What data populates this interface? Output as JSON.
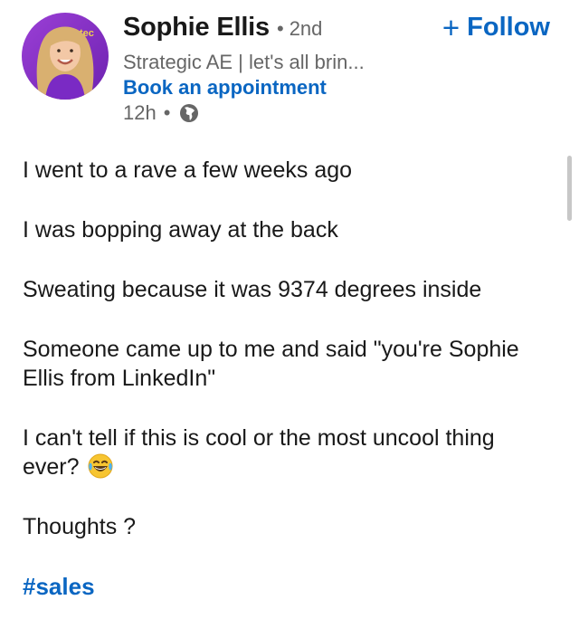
{
  "post": {
    "author": {
      "name": "Sophie Ellis",
      "connection_separator": "•",
      "connection_degree": "2nd",
      "headline": "Strategic AE | let's all brin...",
      "cta_link": "Book an appointment",
      "time_ago": "12h",
      "meta_separator": "•",
      "visibility_icon": "globe-icon",
      "avatar_bg_text": "tec"
    },
    "follow_button": {
      "plus": "+",
      "label": "Follow"
    },
    "paragraphs": [
      "I went to a rave a few weeks ago",
      "I was bopping away at the back",
      "Sweating because it was 9374 degrees inside",
      "Someone came up to me and said \"you're Sophie Ellis from LinkedIn\"",
      "I can't tell if this is cool or the most uncool thing ever?",
      "Thoughts ?"
    ],
    "paragraph_5_emoji": "face-with-tears-of-joy-icon",
    "hashtag": "#sales"
  },
  "colors": {
    "link_blue": "#0a66c2",
    "text_primary": "#191919",
    "text_secondary": "#666666",
    "avatar_bg": "#8b2fc9"
  }
}
